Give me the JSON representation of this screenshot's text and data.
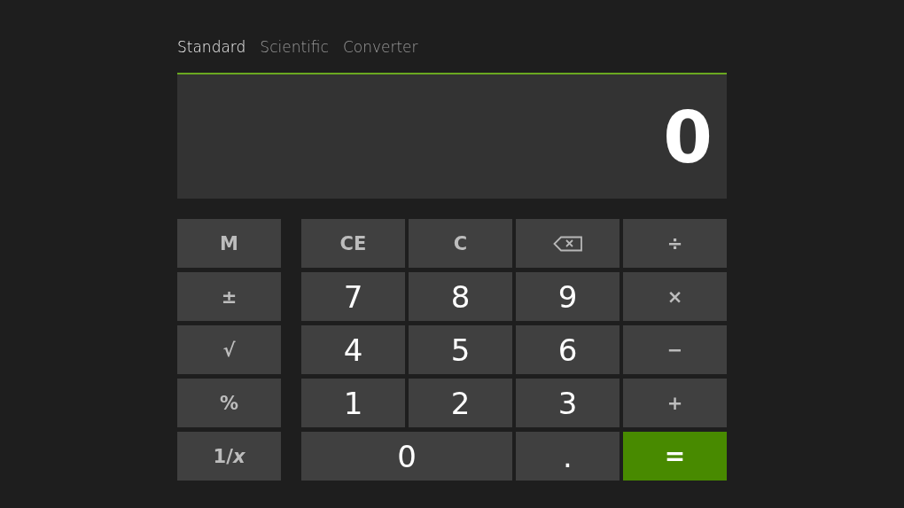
{
  "tabs": [
    {
      "label": "Standard",
      "selected": true
    },
    {
      "label": "Scientific",
      "selected": false
    },
    {
      "label": "Converter",
      "selected": false
    }
  ],
  "display": {
    "value": "0"
  },
  "memory_keys": [
    {
      "label": "M"
    },
    {
      "label": "±"
    },
    {
      "label": "√"
    },
    {
      "label": "%"
    },
    {
      "label": "1/*x*"
    }
  ],
  "keys": [
    {
      "kind": "op",
      "label": "CE",
      "wide": false
    },
    {
      "kind": "op",
      "label": "C",
      "wide": false
    },
    {
      "kind": "backspace",
      "wide": false
    },
    {
      "kind": "op",
      "label": "÷",
      "wide": false
    },
    {
      "kind": "digit",
      "label": "7",
      "wide": false
    },
    {
      "kind": "digit",
      "label": "8",
      "wide": false
    },
    {
      "kind": "digit",
      "label": "9",
      "wide": false
    },
    {
      "kind": "op",
      "label": "×",
      "wide": false
    },
    {
      "kind": "digit",
      "label": "4",
      "wide": false
    },
    {
      "kind": "digit",
      "label": "5",
      "wide": false
    },
    {
      "kind": "digit",
      "label": "6",
      "wide": false
    },
    {
      "kind": "op",
      "label": "−",
      "wide": false
    },
    {
      "kind": "digit",
      "label": "1",
      "wide": false
    },
    {
      "kind": "digit",
      "label": "2",
      "wide": false
    },
    {
      "kind": "digit",
      "label": "3",
      "wide": false
    },
    {
      "kind": "op",
      "label": "+",
      "wide": false
    },
    {
      "kind": "digit",
      "label": "0",
      "wide": true
    },
    {
      "kind": "digit",
      "label": ".",
      "wide": false
    },
    {
      "kind": "equals",
      "label": "=",
      "wide": false
    }
  ]
}
